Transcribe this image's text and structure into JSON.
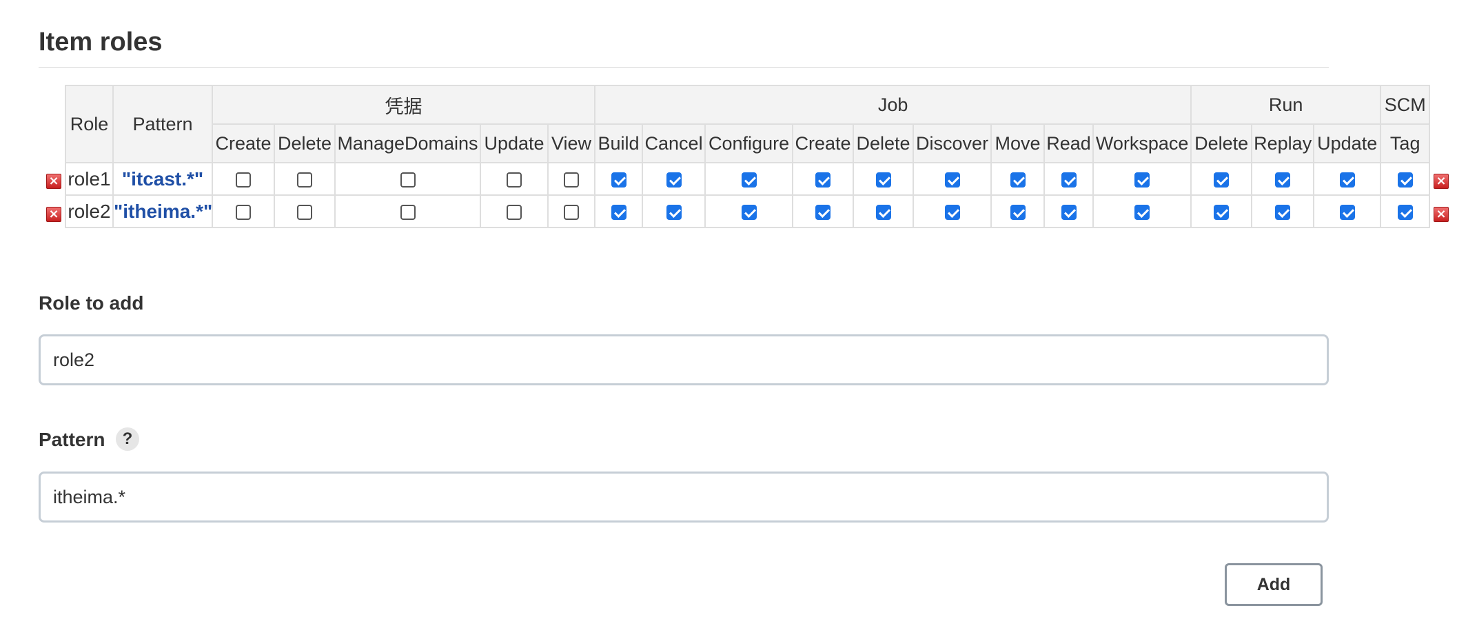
{
  "section_title": "Item roles",
  "table": {
    "role_header": "Role",
    "pattern_header": "Pattern",
    "groups": [
      {
        "name": "凭据",
        "permissions": [
          "Create",
          "Delete",
          "ManageDomains",
          "Update",
          "View"
        ]
      },
      {
        "name": "Job",
        "permissions": [
          "Build",
          "Cancel",
          "Configure",
          "Create",
          "Delete",
          "Discover",
          "Move",
          "Read",
          "Workspace"
        ]
      },
      {
        "name": "Run",
        "permissions": [
          "Delete",
          "Replay",
          "Update"
        ]
      },
      {
        "name": "SCM",
        "permissions": [
          "Tag"
        ]
      }
    ],
    "rows": [
      {
        "role": "role1",
        "pattern": "\"itcast.*\"",
        "checked": [
          false,
          false,
          false,
          false,
          false,
          true,
          true,
          true,
          true,
          true,
          true,
          true,
          true,
          true,
          true,
          true,
          true,
          true
        ]
      },
      {
        "role": "role2",
        "pattern": "\"itheima.*\"",
        "checked": [
          false,
          false,
          false,
          false,
          false,
          true,
          true,
          true,
          true,
          true,
          true,
          true,
          true,
          true,
          true,
          true,
          true,
          true
        ]
      }
    ],
    "delete_icon": "delete-x-icon"
  },
  "form": {
    "role_label": "Role to add",
    "role_value": "role2",
    "pattern_label": "Pattern",
    "pattern_value": "itheima.*",
    "help_label": "?",
    "add_label": "Add"
  },
  "colors": {
    "checkbox_checked": "#1a73e8",
    "pattern_text": "#1f4fa6",
    "delete_icon": "#d9302f",
    "header_bg": "#f3f3f3"
  }
}
